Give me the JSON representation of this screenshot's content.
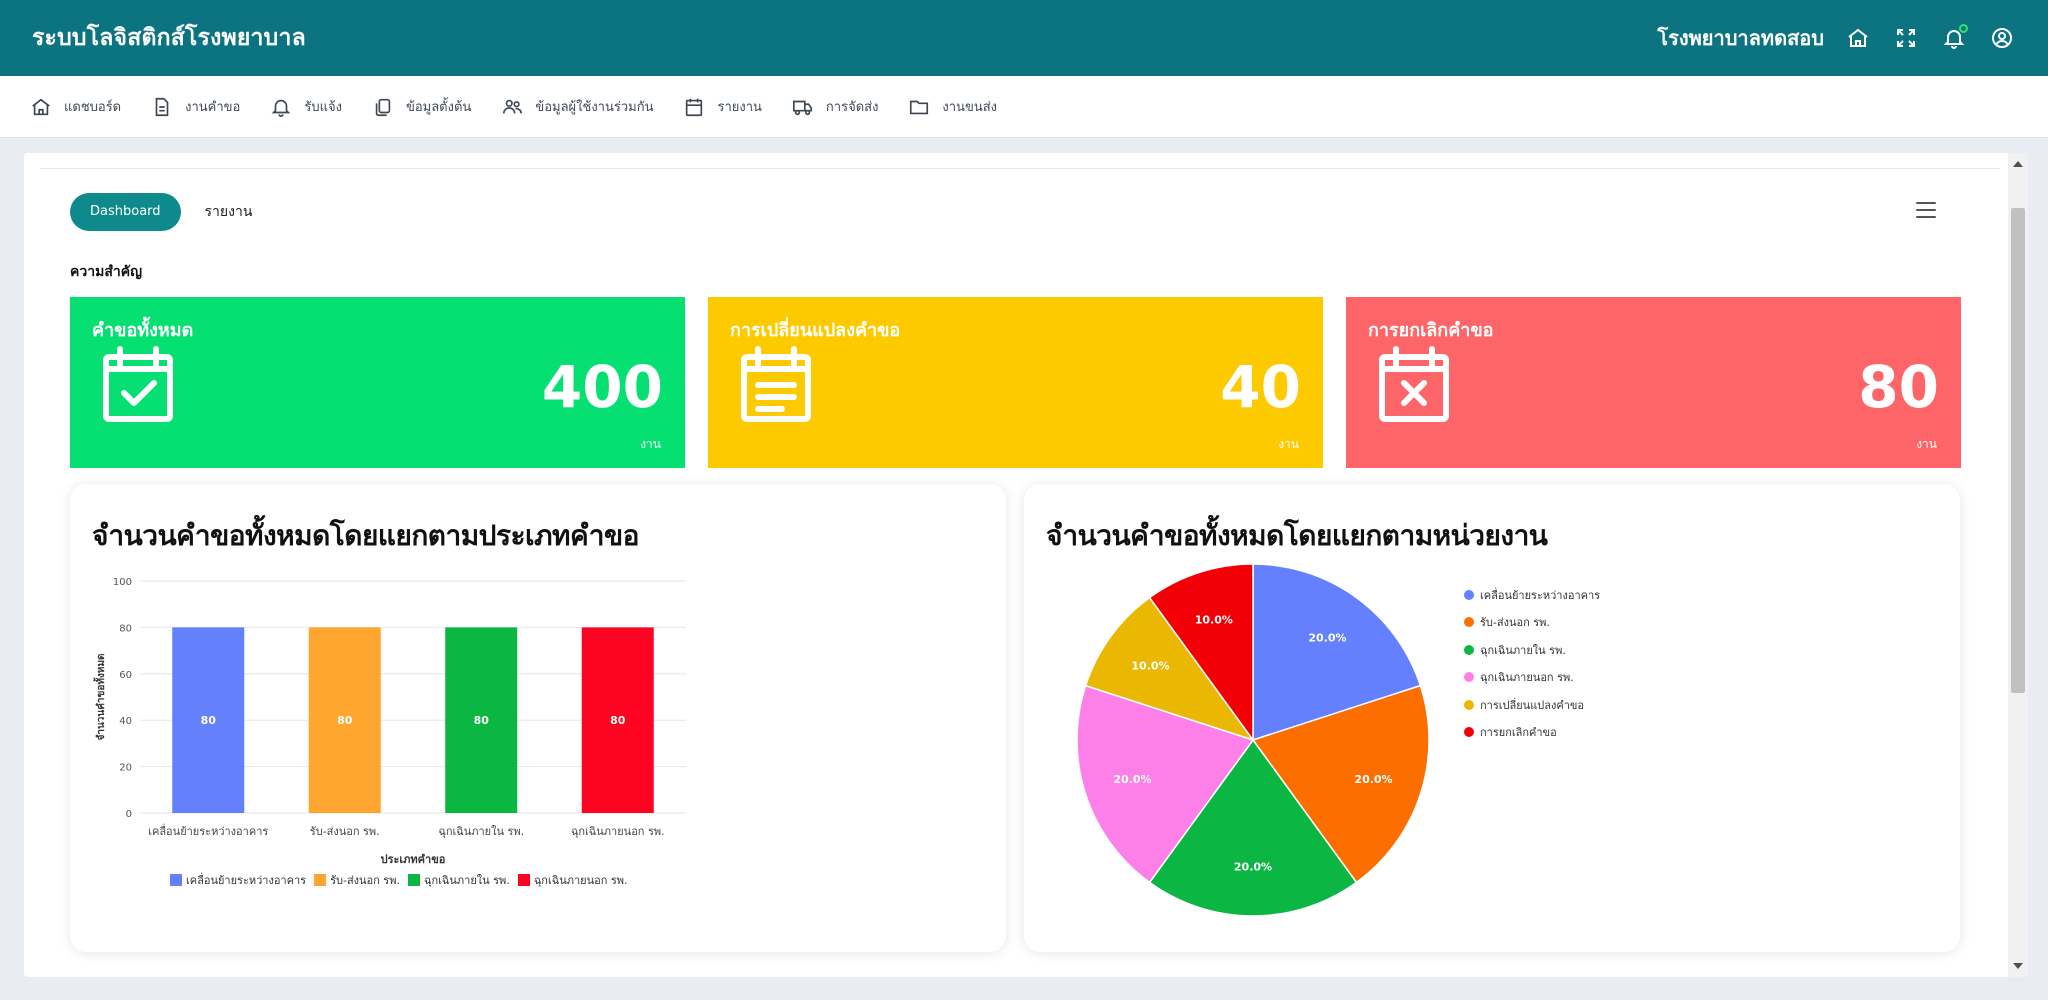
{
  "app": {
    "title": "ระบบโลจิสติกส์โรงพยาบาล",
    "hospital": "โรงพยาบาลทดสอบ"
  },
  "nav": [
    {
      "label": "แดชบอร์ด",
      "icon": "home-icon"
    },
    {
      "label": "งานคำขอ",
      "icon": "document-icon"
    },
    {
      "label": "รับแจ้ง",
      "icon": "bell-icon"
    },
    {
      "label": "ข้อมูลตั้งต้น",
      "icon": "copy-icon"
    },
    {
      "label": "ข้อมูลผู้ใช้งานร่วมกัน",
      "icon": "users-icon"
    },
    {
      "label": "รายงาน",
      "icon": "calendar-icon"
    },
    {
      "label": "การจัดส่ง",
      "icon": "truck-icon"
    },
    {
      "label": "งานขนส่ง",
      "icon": "folder-icon"
    }
  ],
  "tabs": {
    "dashboard": "Dashboard",
    "report": "รายงาน"
  },
  "section_label": "ความสำคัญ",
  "cards": [
    {
      "title": "คำขอทั้งหมด",
      "value": "400",
      "unit": "งาน",
      "color": "#06df72",
      "icon": "calendar-check-icon"
    },
    {
      "title": "การเปลี่ยนแปลงคำขอ",
      "value": "40",
      "unit": "งาน",
      "color": "#fdca00",
      "icon": "calendar-notes-icon"
    },
    {
      "title": "การยกเลิกคำขอ",
      "value": "80",
      "unit": "งาน",
      "color": "#fd6568",
      "icon": "calendar-x-icon"
    }
  ],
  "chart_data": [
    {
      "type": "bar",
      "title": "จำนวนคำขอทั้งหมดโดยแยกตามประเภทคำขอ",
      "xlabel": "ประเภทคำขอ",
      "ylabel": "จำนวนคำขอทั้งหมด",
      "ylim": [
        0,
        100
      ],
      "yticks": [
        0,
        20,
        40,
        60,
        80,
        100
      ],
      "categories": [
        "เคลื่อนย้ายระหว่างอาคาร",
        "รับ-ส่งนอก รพ.",
        "ฉุกเฉินภายใน รพ.",
        "ฉุกเฉินภายนอก รพ."
      ],
      "values": [
        80,
        80,
        80,
        80
      ],
      "colors": [
        "#6480fd",
        "#fea62f",
        "#0bb642",
        "#fe0423"
      ],
      "legend": "bottom",
      "grid": true
    },
    {
      "type": "pie",
      "title": "จำนวนคำขอทั้งหมดโดยแยกตามหน่วยงาน",
      "labels": [
        "เคลื่อนย้ายระหว่างอาคาร",
        "รับ-ส่งนอก รพ.",
        "ฉุกเฉินภายใน รพ.",
        "ฉุกเฉินภายนอก รพ.",
        "การเปลี่ยนแปลงคำขอ",
        "การยกเลิกคำขอ"
      ],
      "values": [
        20.0,
        20.0,
        20.0,
        20.0,
        10.0,
        10.0
      ],
      "display_labels": [
        "20.0%",
        "20.0%",
        "20.0%",
        "20.0%",
        "10.0%",
        "10.0%"
      ],
      "colors": [
        "#6480fd",
        "#fd6e00",
        "#0bb642",
        "#fd80e9",
        "#eab702",
        "#f20006"
      ],
      "legend": "right"
    }
  ]
}
